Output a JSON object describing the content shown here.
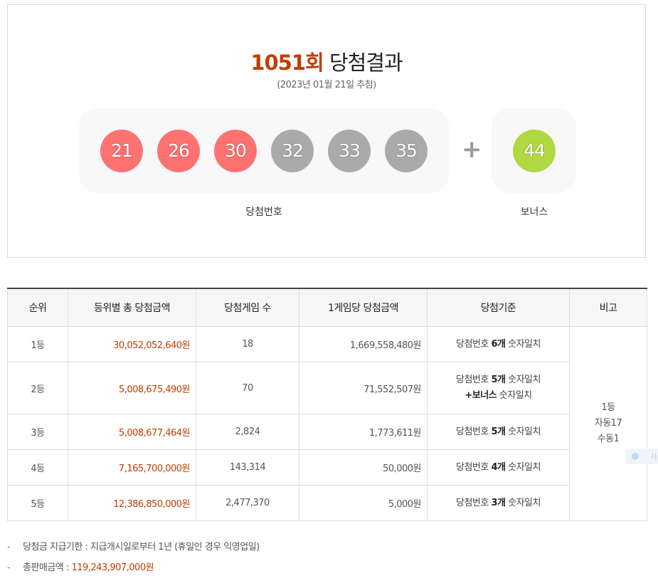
{
  "header": {
    "round": "1051회",
    "title_rest": "당첨결과",
    "draw_date": "(2023년 01월 21일 추첨)"
  },
  "winning_numbers": {
    "balls": [
      {
        "num": "21",
        "color": "#ff7272"
      },
      {
        "num": "26",
        "color": "#ff7272"
      },
      {
        "num": "30",
        "color": "#ff7272"
      },
      {
        "num": "32",
        "color": "#aaaaaa"
      },
      {
        "num": "33",
        "color": "#aaaaaa"
      },
      {
        "num": "35",
        "color": "#aaaaaa"
      }
    ],
    "plus": "+",
    "bonus": {
      "num": "44",
      "color": "#b0d840"
    },
    "label": "당첨번호",
    "bonus_label": "보너스"
  },
  "colors": {
    "accent": "#c33d00"
  },
  "table": {
    "headers": [
      "순위",
      "등위별 총 당첨금액",
      "당첨게임 수",
      "1게임당 당첨금액",
      "당첨기준",
      "비고"
    ],
    "rows": [
      {
        "rank": "1등",
        "total": "30,052,052,640원",
        "games": "18",
        "per_game": "1,669,558,480원",
        "crit_pre": "당첨번호 ",
        "crit_bold": "6개",
        "crit_post": " 숫자일치"
      },
      {
        "rank": "2등",
        "total": "5,008,675,490원",
        "games": "70",
        "per_game": "71,552,507원",
        "crit_pre": "당첨번호 ",
        "crit_bold": "5개",
        "crit_post": " 숫자일치",
        "crit2_bold": "+보너스",
        "crit2_post": " 숫자일치"
      },
      {
        "rank": "3등",
        "total": "5,008,677,464원",
        "games": "2,824",
        "per_game": "1,773,611원",
        "crit_pre": "당첨번호 ",
        "crit_bold": "5개",
        "crit_post": " 숫자일치"
      },
      {
        "rank": "4등",
        "total": "7,165,700,000원",
        "games": "143,314",
        "per_game": "50,000원",
        "crit_pre": "당첨번호 ",
        "crit_bold": "4개",
        "crit_post": " 숫자일치"
      },
      {
        "rank": "5등",
        "total": "12,386,850,000원",
        "games": "2,477,370",
        "per_game": "5,000원",
        "crit_pre": "당첨번호 ",
        "crit_bold": "3개",
        "crit_post": " 숫자일치"
      }
    ],
    "note_lines": [
      "1등",
      "자동17",
      "수동1"
    ]
  },
  "notes": {
    "dash": "-",
    "deadline": "당첨금 지급기한 : 지급개시일로부터 1년 (휴일인 경우 익영업일)",
    "sales_label": "총판매금액 : ",
    "sales_value": "119,243,907,000원"
  },
  "side_widget": {
    "text": "사"
  }
}
